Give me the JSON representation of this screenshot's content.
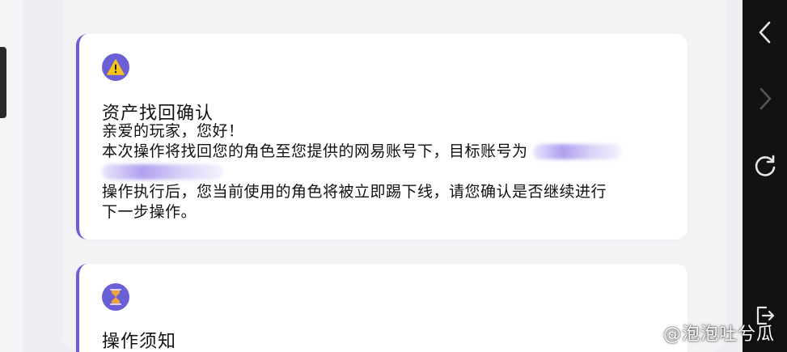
{
  "colors": {
    "accent": "#6a5fd4",
    "warning": "#f6c21c",
    "hourglass": "#f2a23a",
    "card_bg": "#ffffff",
    "page_bg": "#efeff3",
    "text": "#111111"
  },
  "cards": [
    {
      "icon": "warning-icon",
      "title": "资产找回确认",
      "greeting": "亲爱的玩家，您好！",
      "line1": "本次操作将找回您的角色至您提供的网易账号下，目标账号为",
      "line3": "操作执行后，您当前使用的角色将被立即踢下线，请您确认是否继续进行",
      "line4": "下一步操作。"
    },
    {
      "icon": "hourglass-icon",
      "title": "操作须知"
    }
  ],
  "nav": {
    "back": "chevron-left-icon",
    "forward": "chevron-right-icon",
    "refresh": "refresh-icon",
    "exit": "exit-icon"
  },
  "watermark": {
    "icon": "weibo-icon",
    "text": "@泡泡吐兮瓜"
  }
}
